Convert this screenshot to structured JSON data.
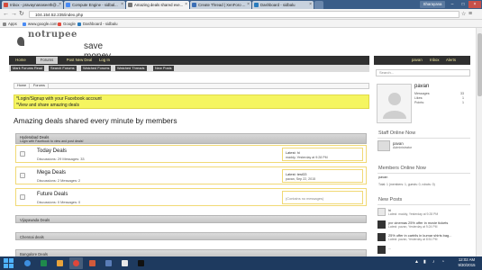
{
  "browser": {
    "tabs": [
      {
        "label": "Inbox - pravaynanaseeth@...",
        "color": "#d54b3d",
        "active": false
      },
      {
        "label": "Compute Engine - sidbal...",
        "color": "#4a8bf5",
        "active": false
      },
      {
        "label": "Amazing deals shared eve...",
        "color": "#777777",
        "active": true
      },
      {
        "label": "Create Thread | XenForo ...",
        "color": "#3b6fb6",
        "active": false
      },
      {
        "label": "Dashboard - sidbalu",
        "color": "#2a7bbd",
        "active": false
      }
    ],
    "profile_label": "Sharayana",
    "url": "104.154.52.235/index.php",
    "bookmarks": [
      {
        "label": "Apps",
        "color": "#888888"
      },
      {
        "label": "www.google.com",
        "color": "#4a8bf5"
      },
      {
        "label": "Google",
        "color": "#e44b3d"
      },
      {
        "label": "Dashboard - sidbalu",
        "color": "#2a7bbd"
      }
    ]
  },
  "site": {
    "logo_top": "notrupee",
    "logo_bottom": "save money",
    "nav": [
      "Home",
      "Forums",
      "Post New Deal",
      "Log In"
    ],
    "nav_right": [
      "pavan",
      "Inbox",
      "Alerts"
    ],
    "subnav": [
      "Mark Forums Read",
      "Search Forums",
      "Watched Forums",
      "Watched Threads",
      "New Posts"
    ],
    "breadcrumb": [
      "Home",
      "Forums"
    ],
    "notice_lines": [
      "*Login/Signup with your Facebook account",
      "*View and share amazing deals"
    ],
    "title": "Amazing deals shared every minute by members",
    "category": {
      "name": "Hyderabad Deals",
      "desc": "Login with Facebook to view and post deals!"
    },
    "forums": [
      {
        "name": "Today Deals",
        "stats": "Discussions: 29 Messages: 33",
        "latest_a": "Latest: hi",
        "latest_b": "maddy, Yesterday at 9:28 PM"
      },
      {
        "name": "Mega Deals",
        "stats": "Discussions: 2 Messages: 2",
        "latest_a": "Latest: test33",
        "latest_b": "pavan, Sep 22, 2015"
      },
      {
        "name": "Future Deals",
        "stats": "Discussions: 0 Messages: 0",
        "latest_a": "(Contains no messages)",
        "latest_b": ""
      }
    ],
    "other_categories": [
      "Vijayawada Deals",
      "Chennai deals",
      "Bangalore Deals"
    ]
  },
  "sidebar": {
    "search_placeholder": "Search...",
    "username": "pavan",
    "stats": [
      {
        "label": "Messages:",
        "value": "33"
      },
      {
        "label": "Likes:",
        "value": "1"
      },
      {
        "label": "Points:",
        "value": "1"
      }
    ],
    "staff_heading": "Staff Online Now",
    "staff_name": "pavan",
    "staff_role": "Administrator",
    "members_heading": "Members Online Now",
    "member": "pavan",
    "online_total": "Total: 1 (members: 1, guests: 0, robots: 0)",
    "new_posts_heading": "New Posts",
    "posts": [
      {
        "title": "hi",
        "meta": "Latest: maddy, Yesterday at 9:28 PM",
        "dark": false
      },
      {
        "title": "pvr cinemas 25% offer in movie tickets",
        "meta": "Latest: pavan, Yesterday at 9:24 PM",
        "dark": true
      },
      {
        "title": "25% offer in cartrils in kumar shirts bag...",
        "meta": "Latest: pavan, Yesterday at 8:51 PM",
        "dark": true
      },
      {
        "title": "...",
        "meta": "",
        "dark": true
      }
    ]
  },
  "taskbar": {
    "time": "12:02 AM",
    "date": "9/30/2015"
  }
}
